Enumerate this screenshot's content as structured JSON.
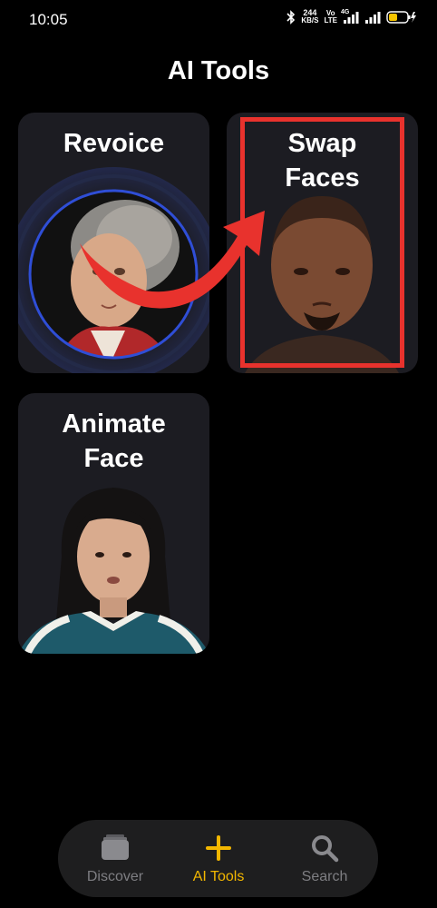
{
  "status_bar": {
    "time": "10:05",
    "net_speed_value": "244",
    "net_speed_unit": "KB/S",
    "volte_top": "Vo",
    "volte_bottom": "LTE",
    "network_type": "4G"
  },
  "page": {
    "title": "AI Tools"
  },
  "cards": {
    "revoice": {
      "title": "Revoice"
    },
    "swap_faces": {
      "title_line1": "Swap",
      "title_line2": "Faces"
    },
    "animate_face": {
      "title_line1": "Animate",
      "title_line2": "Face"
    }
  },
  "bottom_nav": {
    "items": [
      {
        "label": "Discover",
        "icon": "stack-icon",
        "active": false
      },
      {
        "label": "AI Tools",
        "icon": "plus-icon",
        "active": true
      },
      {
        "label": "Search",
        "icon": "search-icon",
        "active": false
      }
    ]
  },
  "colors": {
    "background": "#000000",
    "card": "#1c1c22",
    "accent": "#f3b700",
    "highlight": "#e8322d",
    "inactive": "#7e7e82"
  }
}
